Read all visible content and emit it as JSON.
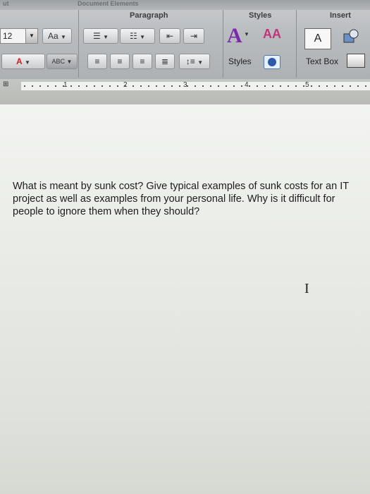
{
  "window": {
    "top_fragment": "ut",
    "top_fragment_2": "Document Elements"
  },
  "ribbon": {
    "groups": {
      "paragraph": "Paragraph",
      "styles": "Styles",
      "insert": "Insert"
    },
    "font_size": "12",
    "grow_font_label": "Aa",
    "styles_button_label": "Styles",
    "text_box_label": "Text Box",
    "text_box_icon_label": "A",
    "font_color_label": "A",
    "highlight_label": "ABC"
  },
  "ruler": {
    "numbers": [
      "1",
      "2",
      "3",
      "4",
      "5"
    ]
  },
  "document": {
    "paragraph": "What is meant by sunk cost? Give typical examples of sunk costs for an IT project as well as examples from your personal life. Why is it difficult for people to ignore them when they should?"
  },
  "cursor": {
    "glyph": "I"
  },
  "colors": {
    "text_color_accent": "#d02020",
    "styles_accent": "#7a2aa8"
  }
}
